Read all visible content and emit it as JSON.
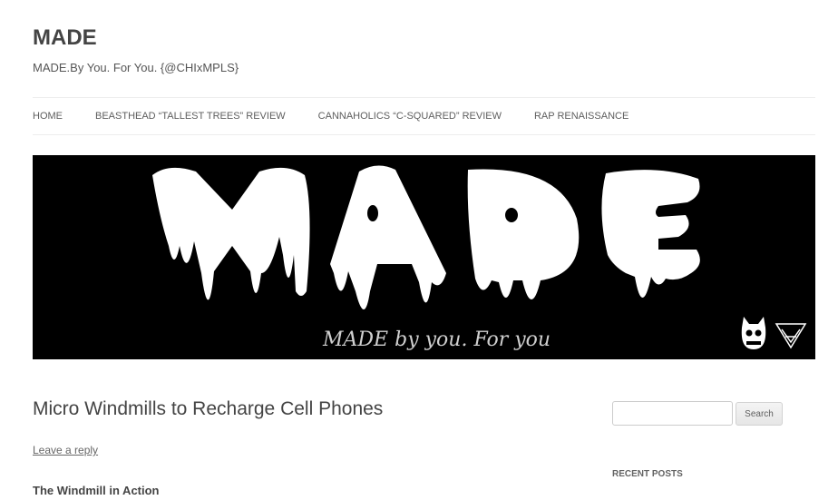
{
  "site": {
    "title": "MADE",
    "tagline": "MADE.By You. For You. {@CHIxMPLS}"
  },
  "nav": {
    "items": [
      {
        "label": "HOME"
      },
      {
        "label": "BEASTHEAD “TALLEST TREES” REVIEW"
      },
      {
        "label": "CANNAHOLICS “C-SQUARED” REVIEW"
      },
      {
        "label": "RAP RENAISSANCE"
      }
    ]
  },
  "banner": {
    "logo_text": "MADE",
    "script_text": "MADE by you. For you",
    "background": "#000000",
    "foreground": "#ffffff",
    "icons": [
      "devil-face-icon",
      "monogram-icon"
    ]
  },
  "post": {
    "title": "Micro Windmills to Recharge Cell Phones",
    "reply_label": "Leave a reply",
    "subheading": "The Windmill in Action"
  },
  "sidebar": {
    "search_placeholder": "",
    "search_button": "Search",
    "recent_posts_title": "RECENT POSTS"
  }
}
